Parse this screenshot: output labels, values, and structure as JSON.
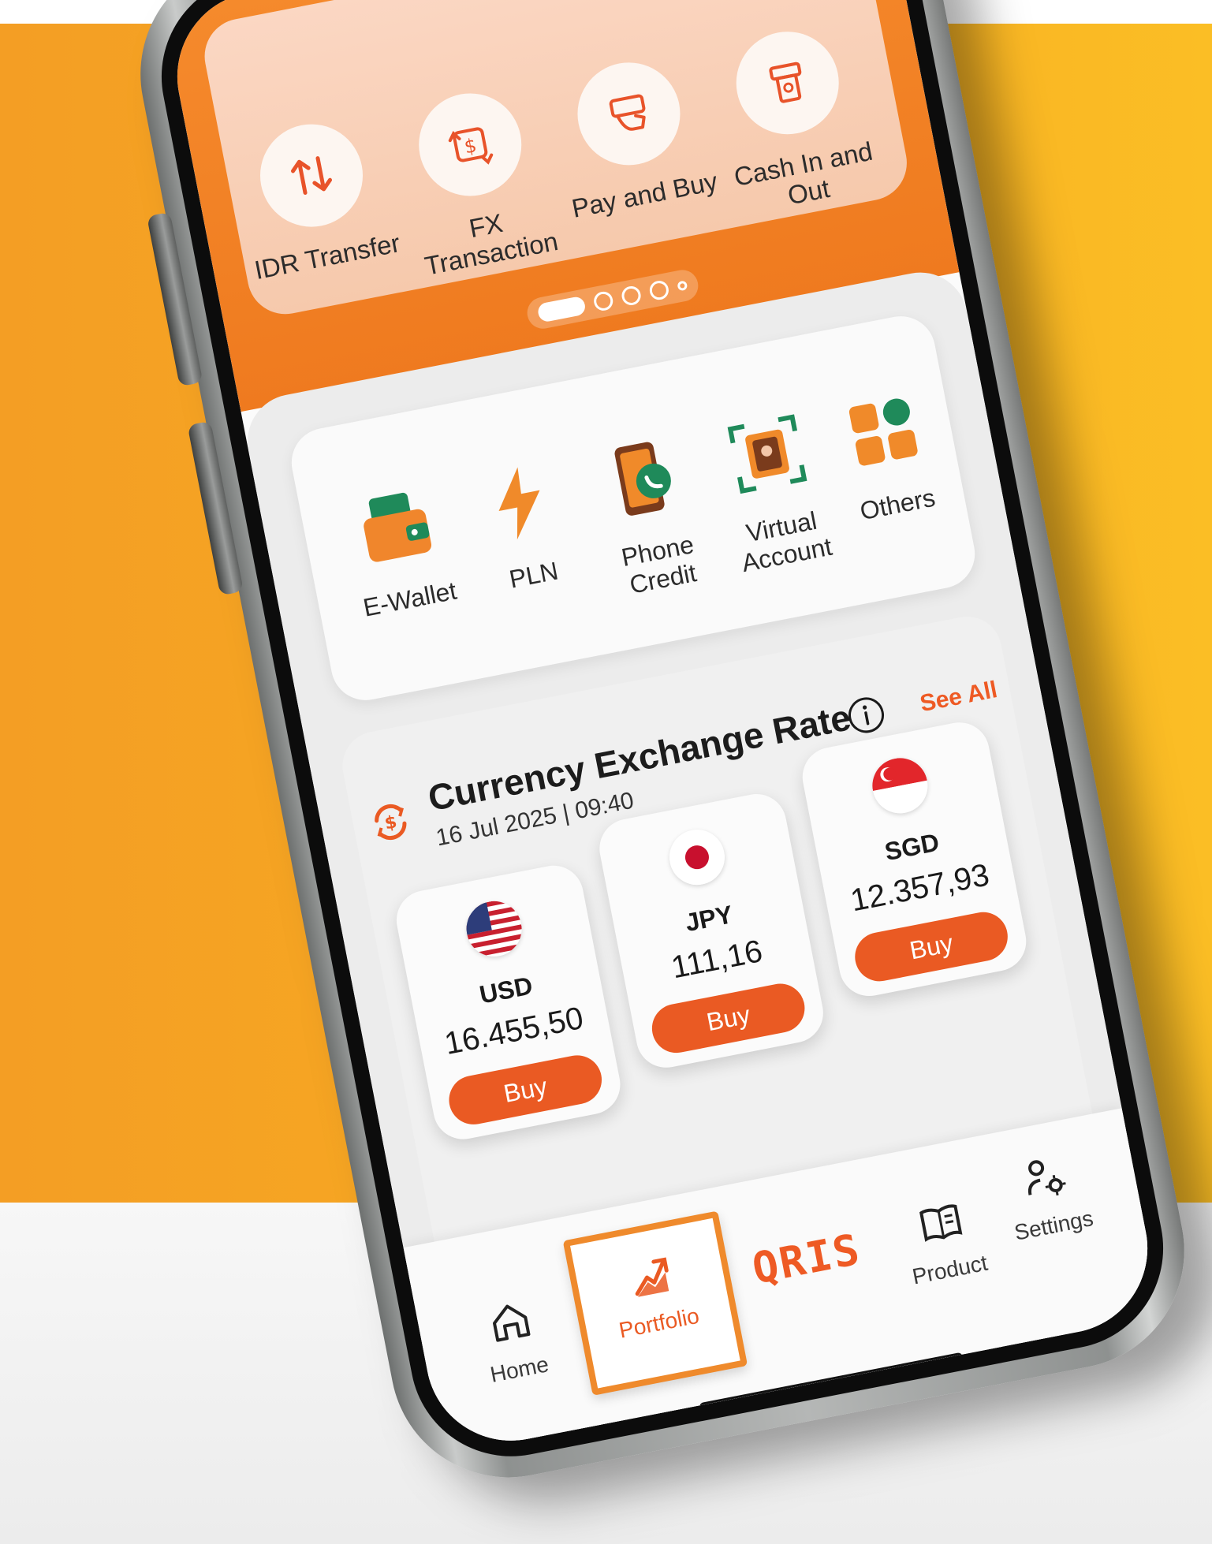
{
  "quick_actions": [
    {
      "label": "IDR Transfer",
      "icon": "transfer-arrows-icon"
    },
    {
      "label": "FX Transaction",
      "icon": "fx-exchange-icon"
    },
    {
      "label": "Pay and Buy",
      "icon": "pay-hand-icon"
    },
    {
      "label": "Cash In and Out",
      "icon": "atm-cash-icon"
    }
  ],
  "carousel": {
    "pages": 5,
    "active": 1
  },
  "services": [
    {
      "label": "E-Wallet",
      "icon": "wallet-icon"
    },
    {
      "label": "PLN",
      "icon": "lightning-icon"
    },
    {
      "label": "Phone Credit",
      "icon": "phone-credit-icon"
    },
    {
      "label": "Virtual Account",
      "icon": "virtual-account-icon"
    },
    {
      "label": "Others",
      "icon": "grid-others-icon"
    }
  ],
  "exchange": {
    "title": "Currency Exchange Rate",
    "timestamp": "16 Jul 2025 | 09:40",
    "see_all": "See All",
    "rates": [
      {
        "code": "USD",
        "value": "16.455,50",
        "buy": "Buy",
        "flag": "us-flag-icon"
      },
      {
        "code": "JPY",
        "value": "111,16",
        "buy": "Buy",
        "flag": "jp-flag-icon"
      },
      {
        "code": "SGD",
        "value": "12.357,93",
        "buy": "Buy",
        "flag": "sg-flag-icon"
      }
    ]
  },
  "nav": {
    "home": "Home",
    "portfolio": "Portfolio",
    "qris": "QRIS",
    "product": "Product",
    "settings": "Settings",
    "active": "Portfolio"
  },
  "colors": {
    "accent": "#ea5a23",
    "header": "#f58a2c",
    "background_left": "#f49e24",
    "background_right": "#fbbe25"
  }
}
